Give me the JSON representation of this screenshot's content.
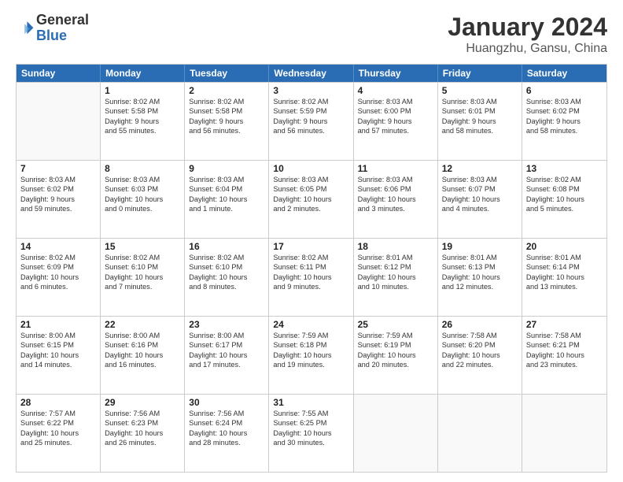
{
  "logo": {
    "text_general": "General",
    "text_blue": "Blue"
  },
  "title": "January 2024",
  "subtitle": "Huangzhu, Gansu, China",
  "header_days": [
    "Sunday",
    "Monday",
    "Tuesday",
    "Wednesday",
    "Thursday",
    "Friday",
    "Saturday"
  ],
  "weeks": [
    [
      {
        "day": "",
        "lines": []
      },
      {
        "day": "1",
        "lines": [
          "Sunrise: 8:02 AM",
          "Sunset: 5:58 PM",
          "Daylight: 9 hours",
          "and 55 minutes."
        ]
      },
      {
        "day": "2",
        "lines": [
          "Sunrise: 8:02 AM",
          "Sunset: 5:58 PM",
          "Daylight: 9 hours",
          "and 56 minutes."
        ]
      },
      {
        "day": "3",
        "lines": [
          "Sunrise: 8:02 AM",
          "Sunset: 5:59 PM",
          "Daylight: 9 hours",
          "and 56 minutes."
        ]
      },
      {
        "day": "4",
        "lines": [
          "Sunrise: 8:03 AM",
          "Sunset: 6:00 PM",
          "Daylight: 9 hours",
          "and 57 minutes."
        ]
      },
      {
        "day": "5",
        "lines": [
          "Sunrise: 8:03 AM",
          "Sunset: 6:01 PM",
          "Daylight: 9 hours",
          "and 58 minutes."
        ]
      },
      {
        "day": "6",
        "lines": [
          "Sunrise: 8:03 AM",
          "Sunset: 6:02 PM",
          "Daylight: 9 hours",
          "and 58 minutes."
        ]
      }
    ],
    [
      {
        "day": "7",
        "lines": [
          "Sunrise: 8:03 AM",
          "Sunset: 6:02 PM",
          "Daylight: 9 hours",
          "and 59 minutes."
        ]
      },
      {
        "day": "8",
        "lines": [
          "Sunrise: 8:03 AM",
          "Sunset: 6:03 PM",
          "Daylight: 10 hours",
          "and 0 minutes."
        ]
      },
      {
        "day": "9",
        "lines": [
          "Sunrise: 8:03 AM",
          "Sunset: 6:04 PM",
          "Daylight: 10 hours",
          "and 1 minute."
        ]
      },
      {
        "day": "10",
        "lines": [
          "Sunrise: 8:03 AM",
          "Sunset: 6:05 PM",
          "Daylight: 10 hours",
          "and 2 minutes."
        ]
      },
      {
        "day": "11",
        "lines": [
          "Sunrise: 8:03 AM",
          "Sunset: 6:06 PM",
          "Daylight: 10 hours",
          "and 3 minutes."
        ]
      },
      {
        "day": "12",
        "lines": [
          "Sunrise: 8:03 AM",
          "Sunset: 6:07 PM",
          "Daylight: 10 hours",
          "and 4 minutes."
        ]
      },
      {
        "day": "13",
        "lines": [
          "Sunrise: 8:02 AM",
          "Sunset: 6:08 PM",
          "Daylight: 10 hours",
          "and 5 minutes."
        ]
      }
    ],
    [
      {
        "day": "14",
        "lines": [
          "Sunrise: 8:02 AM",
          "Sunset: 6:09 PM",
          "Daylight: 10 hours",
          "and 6 minutes."
        ]
      },
      {
        "day": "15",
        "lines": [
          "Sunrise: 8:02 AM",
          "Sunset: 6:10 PM",
          "Daylight: 10 hours",
          "and 7 minutes."
        ]
      },
      {
        "day": "16",
        "lines": [
          "Sunrise: 8:02 AM",
          "Sunset: 6:10 PM",
          "Daylight: 10 hours",
          "and 8 minutes."
        ]
      },
      {
        "day": "17",
        "lines": [
          "Sunrise: 8:02 AM",
          "Sunset: 6:11 PM",
          "Daylight: 10 hours",
          "and 9 minutes."
        ]
      },
      {
        "day": "18",
        "lines": [
          "Sunrise: 8:01 AM",
          "Sunset: 6:12 PM",
          "Daylight: 10 hours",
          "and 10 minutes."
        ]
      },
      {
        "day": "19",
        "lines": [
          "Sunrise: 8:01 AM",
          "Sunset: 6:13 PM",
          "Daylight: 10 hours",
          "and 12 minutes."
        ]
      },
      {
        "day": "20",
        "lines": [
          "Sunrise: 8:01 AM",
          "Sunset: 6:14 PM",
          "Daylight: 10 hours",
          "and 13 minutes."
        ]
      }
    ],
    [
      {
        "day": "21",
        "lines": [
          "Sunrise: 8:00 AM",
          "Sunset: 6:15 PM",
          "Daylight: 10 hours",
          "and 14 minutes."
        ]
      },
      {
        "day": "22",
        "lines": [
          "Sunrise: 8:00 AM",
          "Sunset: 6:16 PM",
          "Daylight: 10 hours",
          "and 16 minutes."
        ]
      },
      {
        "day": "23",
        "lines": [
          "Sunrise: 8:00 AM",
          "Sunset: 6:17 PM",
          "Daylight: 10 hours",
          "and 17 minutes."
        ]
      },
      {
        "day": "24",
        "lines": [
          "Sunrise: 7:59 AM",
          "Sunset: 6:18 PM",
          "Daylight: 10 hours",
          "and 19 minutes."
        ]
      },
      {
        "day": "25",
        "lines": [
          "Sunrise: 7:59 AM",
          "Sunset: 6:19 PM",
          "Daylight: 10 hours",
          "and 20 minutes."
        ]
      },
      {
        "day": "26",
        "lines": [
          "Sunrise: 7:58 AM",
          "Sunset: 6:20 PM",
          "Daylight: 10 hours",
          "and 22 minutes."
        ]
      },
      {
        "day": "27",
        "lines": [
          "Sunrise: 7:58 AM",
          "Sunset: 6:21 PM",
          "Daylight: 10 hours",
          "and 23 minutes."
        ]
      }
    ],
    [
      {
        "day": "28",
        "lines": [
          "Sunrise: 7:57 AM",
          "Sunset: 6:22 PM",
          "Daylight: 10 hours",
          "and 25 minutes."
        ]
      },
      {
        "day": "29",
        "lines": [
          "Sunrise: 7:56 AM",
          "Sunset: 6:23 PM",
          "Daylight: 10 hours",
          "and 26 minutes."
        ]
      },
      {
        "day": "30",
        "lines": [
          "Sunrise: 7:56 AM",
          "Sunset: 6:24 PM",
          "Daylight: 10 hours",
          "and 28 minutes."
        ]
      },
      {
        "day": "31",
        "lines": [
          "Sunrise: 7:55 AM",
          "Sunset: 6:25 PM",
          "Daylight: 10 hours",
          "and 30 minutes."
        ]
      },
      {
        "day": "",
        "lines": []
      },
      {
        "day": "",
        "lines": []
      },
      {
        "day": "",
        "lines": []
      }
    ]
  ]
}
